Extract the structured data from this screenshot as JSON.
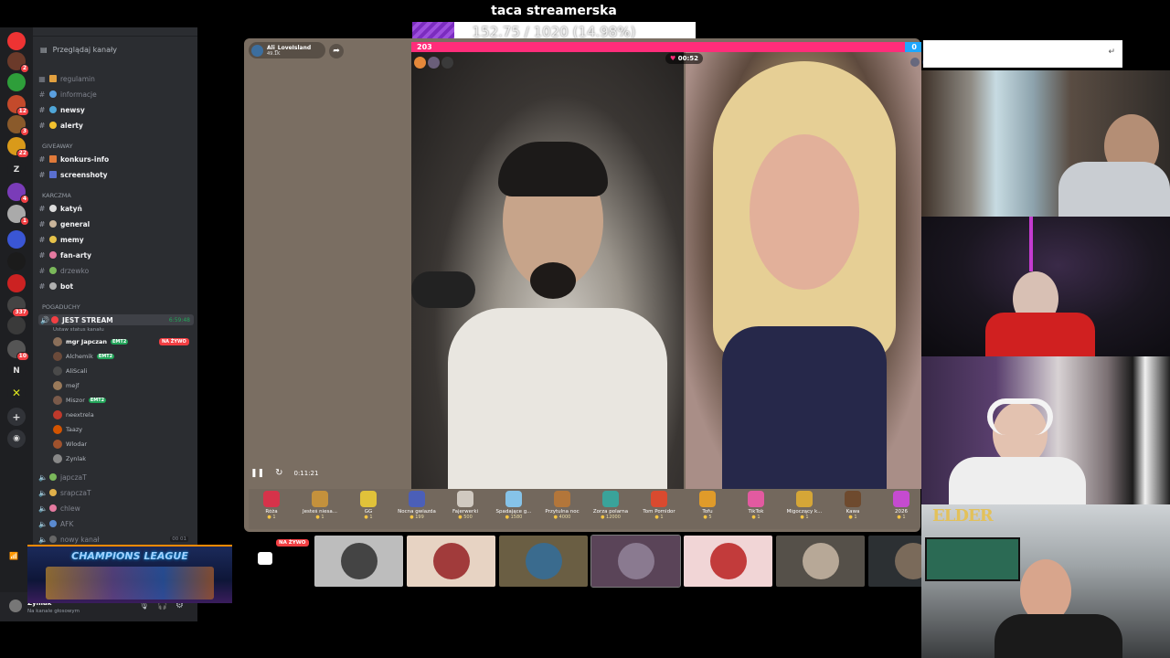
{
  "overlay": {
    "goal_title": "taca streamerska",
    "goal_text": "152.75 / 1020 (14.98%)",
    "goal_progress": 0.1498
  },
  "discord": {
    "browse_label": "Przeglądaj kanały",
    "server_badges": [
      "2",
      "12",
      "3",
      "22",
      "4",
      "1",
      "337",
      "10"
    ],
    "server_letters": [
      "Z",
      "N"
    ],
    "channels_top": [
      {
        "name": "regulamin",
        "bold": false
      },
      {
        "name": "informacje",
        "bold": false
      },
      {
        "name": "newsy",
        "bold": true
      },
      {
        "name": "alerty",
        "bold": true
      }
    ],
    "cat_giveaway": "GIVEAWAY",
    "channels_giveaway": [
      {
        "name": "konkurs-info",
        "bold": true
      },
      {
        "name": "screenshoty",
        "bold": true
      }
    ],
    "cat_karczma": "KARCZMA",
    "channels_karczma": [
      {
        "name": "katyń",
        "bold": true
      },
      {
        "name": "general",
        "bold": true
      },
      {
        "name": "memy",
        "bold": true
      },
      {
        "name": "fan-arty",
        "bold": true
      },
      {
        "name": "drzewko",
        "bold": false
      },
      {
        "name": "bot",
        "bold": true
      }
    ],
    "cat_pogaduchy": "POGADUCHY",
    "voice_active": "JEST STREAM",
    "voice_active_time": "6:59:48",
    "voice_status": "Ustaw status kanału",
    "voice_users": [
      {
        "name": "mgr Japczan",
        "tag": "EMT2"
      },
      {
        "name": "Alchemik",
        "tag": "EMT2"
      },
      {
        "name": "AliScali",
        "tag": ""
      },
      {
        "name": "mejf",
        "tag": ""
      },
      {
        "name": "Miszor",
        "tag": "EMT2"
      },
      {
        "name": "neextrela",
        "tag": ""
      },
      {
        "name": "Taazy",
        "tag": ""
      },
      {
        "name": "Wlodar",
        "tag": ""
      },
      {
        "name": "Zynlak",
        "tag": ""
      }
    ],
    "live_badge": "NA ŻYWO",
    "voice_channels": [
      "japczaT",
      "srapczaT",
      "chlew",
      "AFK",
      "nowy kanał"
    ],
    "nowy_count": "00",
    "nowy_cap": "01",
    "user": {
      "name": "Zyniak",
      "status": "Na kanale głosowym"
    },
    "banner_text": "CHAMPIONS LEAGUE"
  },
  "tiktok": {
    "host_name": "Ali_LoveIsland",
    "host_sub": "49.1K",
    "pk_left": "203",
    "pk_right": "0",
    "timer": "00:52",
    "elapsed": "0:11:21",
    "gifts": [
      {
        "name": "Róża",
        "price": "1",
        "color": "#d6334a"
      },
      {
        "name": "Jesteś niesa...",
        "price": "1",
        "color": "#c4913c"
      },
      {
        "name": "GG",
        "price": "1",
        "color": "#e0c23a"
      },
      {
        "name": "Nocna gwiazda",
        "price": "199",
        "color": "#4b5fb8"
      },
      {
        "name": "Fajerwerki",
        "price": "500",
        "color": "#d0c9c0"
      },
      {
        "name": "Spadające g...",
        "price": "1580",
        "color": "#86c3e8"
      },
      {
        "name": "Przytulna noc",
        "price": "4000",
        "color": "#b3763a"
      },
      {
        "name": "Zorza polarna",
        "price": "12000",
        "color": "#3aa39a"
      },
      {
        "name": "Tom Pomidor",
        "price": "1",
        "color": "#d94a2f"
      },
      {
        "name": "Tofu",
        "price": "5",
        "color": "#e09b2a"
      },
      {
        "name": "TikTok",
        "price": "1",
        "color": "#e25aa0"
      },
      {
        "name": "Migoczący k...",
        "price": "1",
        "color": "#d5a637"
      },
      {
        "name": "Kawa",
        "price": "1",
        "color": "#6e4a2e"
      },
      {
        "name": "2026",
        "price": "1",
        "color": "#c54bd0"
      }
    ],
    "live_label": "NA ŻYWO",
    "stream_tiles": [
      {
        "bg": "#bdbdbd",
        "icon": "#444444"
      },
      {
        "bg": "#e7d3c3",
        "icon": "#a13b3b"
      },
      {
        "bg": "#6a5e43",
        "icon": "#3a6b8e"
      },
      {
        "bg": "#5a4458",
        "icon": "#8a7a90"
      },
      {
        "bg": "#f1d5d6",
        "icon": "#c23b3b"
      },
      {
        "bg": "#555049",
        "icon": "#b7a897"
      },
      {
        "bg": "#2c3033",
        "icon": "#7a6a5a"
      }
    ]
  },
  "cams": {
    "elder_label": "ELDER"
  },
  "colors": {
    "pk_pink": "#ff2d7a",
    "pk_blue": "#1ea7ff",
    "goal_purple": "#7b2cbf",
    "discord_bg": "#2b2d31"
  }
}
